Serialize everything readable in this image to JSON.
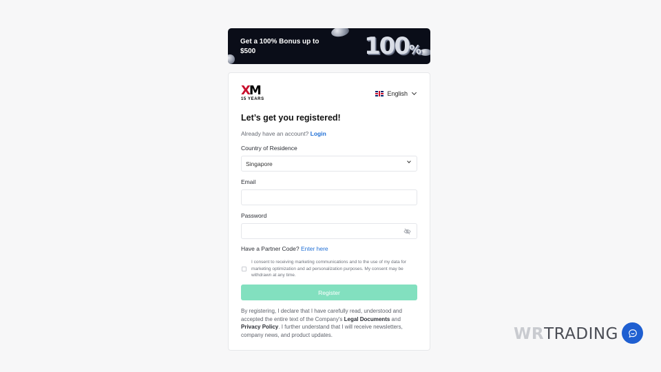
{
  "banner": {
    "headline": "Get a 100% Bonus up to $500",
    "big_number": "100",
    "big_suffix": "%"
  },
  "brand": {
    "logo_x": "X",
    "logo_m": "M",
    "years": "15 YEARS",
    "accent": "#c8102e"
  },
  "language": {
    "selected": "English",
    "flag": "uk-flag-icon"
  },
  "form": {
    "title": "Let’s get you registered!",
    "already_text": "Already have an account?",
    "login_link": "Login",
    "country_label": "Country of Residence",
    "country_value": "Singapore",
    "email_label": "Email",
    "email_value": "",
    "password_label": "Password",
    "password_value": "",
    "partner_text": "Have a Partner Code?",
    "partner_link": "Enter here",
    "consent_text": "I consent to receiving marketing communications and to the use of my data for marketing optimization and ad personalization purposes. My consent may be withdrawn at any time.",
    "register_label": "Register",
    "register_color": "#82e0bf",
    "legal_1": "By registering, I declare that I have carefully read, understood and accepted the entire text of the Company's",
    "legal_docs": "Legal Documents",
    "legal_and": "and",
    "legal_privacy": "Privacy Policy",
    "legal_2": ". I further understand that I will receive newsletters, company news, and product updates."
  },
  "watermark": {
    "part_a": "WR",
    "part_b": "TRADING"
  },
  "chat": {
    "icon": "chat-bubble-icon",
    "color": "#1f5fd1"
  }
}
